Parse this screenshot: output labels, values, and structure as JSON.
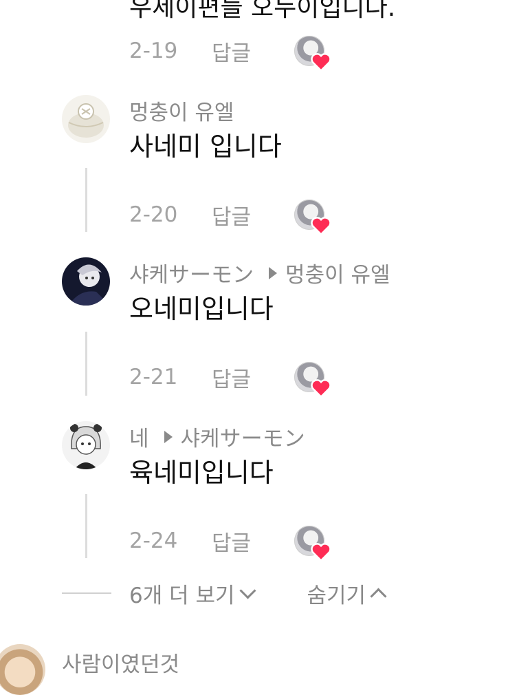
{
  "top_partial": {
    "text": "우세이편들 오누이입니다.",
    "date": "2-19",
    "reply_label": "답글"
  },
  "comments": [
    {
      "author": "멍충이 유엘",
      "reply_to": "",
      "text": "사네미 입니다",
      "date": "2-20",
      "reply_label": "답글"
    },
    {
      "author": "샤케サーモン",
      "reply_to": "멍충이 유엘",
      "text": "오네미입니다",
      "date": "2-21",
      "reply_label": "답글"
    },
    {
      "author": "네",
      "reply_to": "샤케サーモン",
      "text": "육네미입니다",
      "date": "2-24",
      "reply_label": "답글"
    }
  ],
  "thread_controls": {
    "more_label": "6개 더 보기",
    "hide_label": "숨기기"
  },
  "next_comment": {
    "author": "사람이였던것"
  },
  "colors": {
    "heart": "#fe2c55",
    "meta_text": "#8a8a8a",
    "body_text": "#111111",
    "thread_line": "#dcdcdc"
  }
}
